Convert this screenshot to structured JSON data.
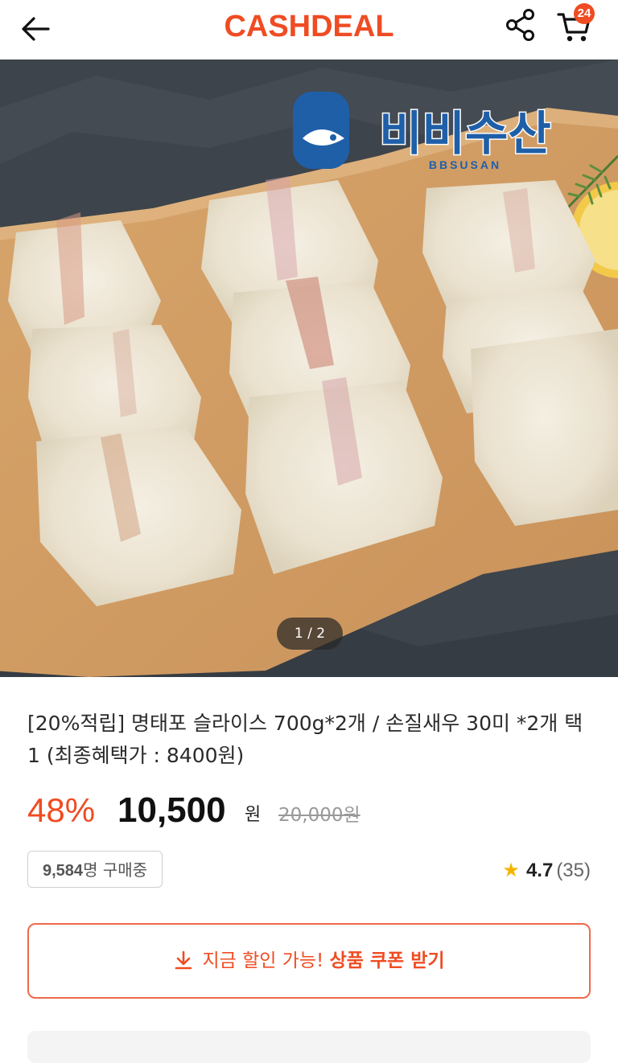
{
  "header": {
    "brand": "CASHDEAL",
    "cart_count": "24"
  },
  "hero": {
    "seller_logo": "비비수산",
    "seller_logo_en": "BBSUSAN",
    "page_indicator": "1 / 2"
  },
  "product": {
    "title": "[20%적립] 명태포 슬라이스 700g*2개 / 손질새우 30미 *2개 택1 (최종혜택가 : 8400원)",
    "discount": "48%",
    "price": "10,500",
    "currency": "원",
    "original_price": "20,000원",
    "buyers_count": "9,584",
    "buyers_suffix": "명 구매중",
    "rating": "4.7",
    "review_count": "(35)"
  },
  "coupon": {
    "lead": "지금 할인 가능! ",
    "strong": "상품 쿠폰 받기"
  },
  "colors": {
    "accent": "#ef4c23",
    "star": "#f5b400"
  },
  "icons": [
    "back-arrow-icon",
    "share-icon",
    "cart-icon",
    "download-icon",
    "star-icon"
  ]
}
